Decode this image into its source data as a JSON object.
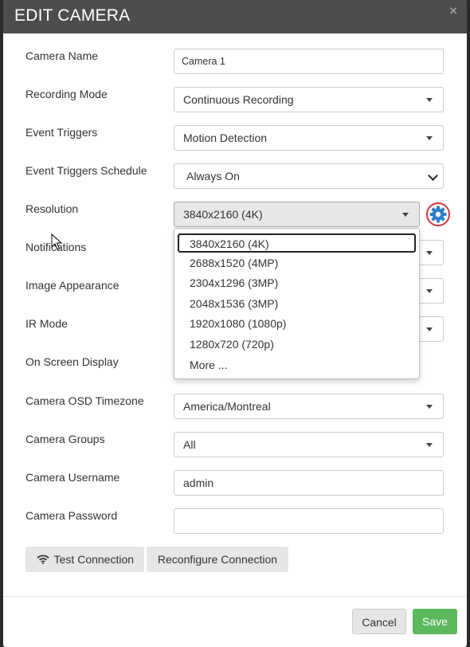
{
  "modal": {
    "title": "EDIT CAMERA",
    "close_label": "×"
  },
  "fields": {
    "camera_name": {
      "label": "Camera Name",
      "value": "Camera 1"
    },
    "recording_mode": {
      "label": "Recording Mode",
      "value": "Continuous Recording"
    },
    "event_triggers": {
      "label": "Event Triggers",
      "value": "Motion Detection"
    },
    "event_triggers_schedule": {
      "label": "Event Triggers Schedule",
      "value": "Always On"
    },
    "resolution": {
      "label": "Resolution",
      "value": "3840x2160 (4K)"
    },
    "notifications": {
      "label": "Notifications"
    },
    "image_appearance": {
      "label": "Image Appearance"
    },
    "ir_mode": {
      "label": "IR Mode"
    },
    "on_screen_display": {
      "label": "On Screen Display"
    },
    "camera_osd_timezone": {
      "label": "Camera OSD Timezone",
      "value": "America/Montreal"
    },
    "camera_groups": {
      "label": "Camera Groups",
      "value": "All"
    },
    "camera_username": {
      "label": "Camera Username",
      "value": "admin"
    },
    "camera_password": {
      "label": "Camera Password",
      "value": ""
    }
  },
  "resolution_options": [
    "3840x2160 (4K)",
    "2688x1520 (4MP)",
    "2304x1296 (3MP)",
    "2048x1536 (3MP)",
    "1920x1080 (1080p)",
    "1280x720 (720p)",
    "More ..."
  ],
  "buttons": {
    "test_connection": "Test Connection",
    "reconfigure_connection": "Reconfigure Connection",
    "cancel": "Cancel",
    "save": "Save"
  },
  "colors": {
    "header": "#4d4d4d",
    "save": "#5cb85c",
    "gear": "#2f7fc9",
    "gear_ring": "#d9363e"
  },
  "icons": {
    "gear": "gear-icon",
    "wifi": "wifi-icon",
    "close": "close-icon",
    "cursor": "mouse-cursor-icon"
  }
}
